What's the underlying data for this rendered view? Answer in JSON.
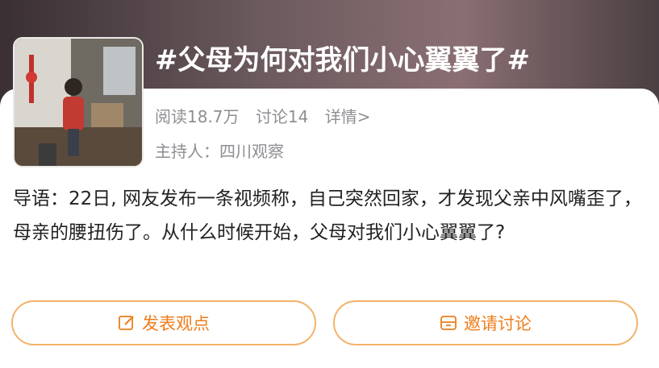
{
  "topic": {
    "title": "#父母为何对我们小心翼翼了#",
    "reads": "阅读18.7万",
    "discussions": "讨论14",
    "details": "详情>",
    "host": "主持人：四川观察"
  },
  "intro": "导语：22日, 网友发布一条视频称，自己突然回家，才发现父亲中风嘴歪了，母亲的腰扭伤了。从什么时候开始，父母对我们小心翼翼了?",
  "actions": {
    "post": {
      "label": "发表观点",
      "icon": "edit-icon"
    },
    "invite": {
      "label": "邀请讨论",
      "icon": "invite-icon"
    }
  },
  "colors": {
    "accent": "#ee7d1a",
    "button_border": "#f3b26a",
    "meta_text": "#8e8e93"
  }
}
